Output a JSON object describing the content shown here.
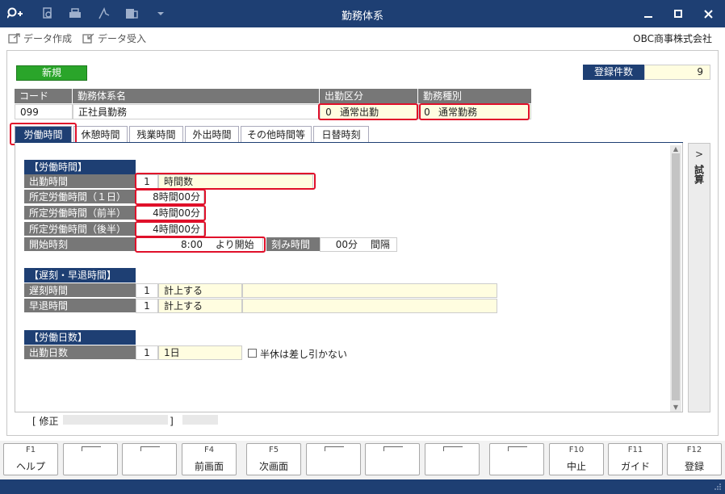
{
  "window": {
    "title": "勤務体系"
  },
  "toolbar": {
    "create_label": "データ作成",
    "receive_label": "データ受入"
  },
  "company": "OBC商事株式会社",
  "status": {
    "mode": "新規",
    "count_label": "登録件数",
    "count_value": "9"
  },
  "header_grid": {
    "columns": [
      "コード",
      "勤務体系名",
      "出勤区分",
      "勤務種別"
    ],
    "code": "099",
    "name": "正社員勤務",
    "attendance_num": "0",
    "attendance_val": "通常出勤",
    "work_type_num": "0",
    "work_type_val": "通常勤務"
  },
  "tabs": [
    "労働時間",
    "休憩時間",
    "残業時間",
    "外出時間",
    "その他時間等",
    "日替時刻"
  ],
  "side_panel": {
    "arrow": ">",
    "label": "試算"
  },
  "work_time": {
    "section": "【労働時間】",
    "attendance_label": "出勤時間",
    "attendance_num": "1",
    "attendance_val": "時間数",
    "std_day_label": "所定労働時間（１日）",
    "std_day_val": "8時間00分",
    "std_first_label": "所定労働時間（前半）",
    "std_first_val": "4時間00分",
    "std_second_label": "所定労働時間（後半）",
    "std_second_val": "4時間00分",
    "start_label": "開始時刻",
    "start_val": "8:00",
    "start_suffix": "より開始",
    "interval_label": "刻み時間",
    "interval_val": "00分",
    "interval_suffix": "間隔"
  },
  "late_early": {
    "section": "【遅刻・早退時間】",
    "late_label": "遅刻時間",
    "late_num": "1",
    "late_val": "計上する",
    "early_label": "早退時間",
    "early_num": "1",
    "early_val": "計上する"
  },
  "work_days": {
    "section": "【労働日数】",
    "days_label": "出勤日数",
    "days_num": "1",
    "days_val": "1日",
    "half_holiday_label": "半休は差し引かない"
  },
  "modified": {
    "prefix": "[ 修正",
    "suffix": "]"
  },
  "fkeys": [
    {
      "key": "F1",
      "label": "ヘルプ"
    },
    {
      "key": "",
      "label": ""
    },
    {
      "key": "",
      "label": ""
    },
    {
      "key": "F4",
      "label": "前画面"
    },
    {
      "key": "F5",
      "label": "次画面"
    },
    {
      "key": "",
      "label": ""
    },
    {
      "key": "",
      "label": ""
    },
    {
      "key": "",
      "label": ""
    },
    {
      "key": "",
      "label": ""
    },
    {
      "key": "F10",
      "label": "中止"
    },
    {
      "key": "F11",
      "label": "ガイド"
    },
    {
      "key": "F12",
      "label": "登録"
    }
  ]
}
